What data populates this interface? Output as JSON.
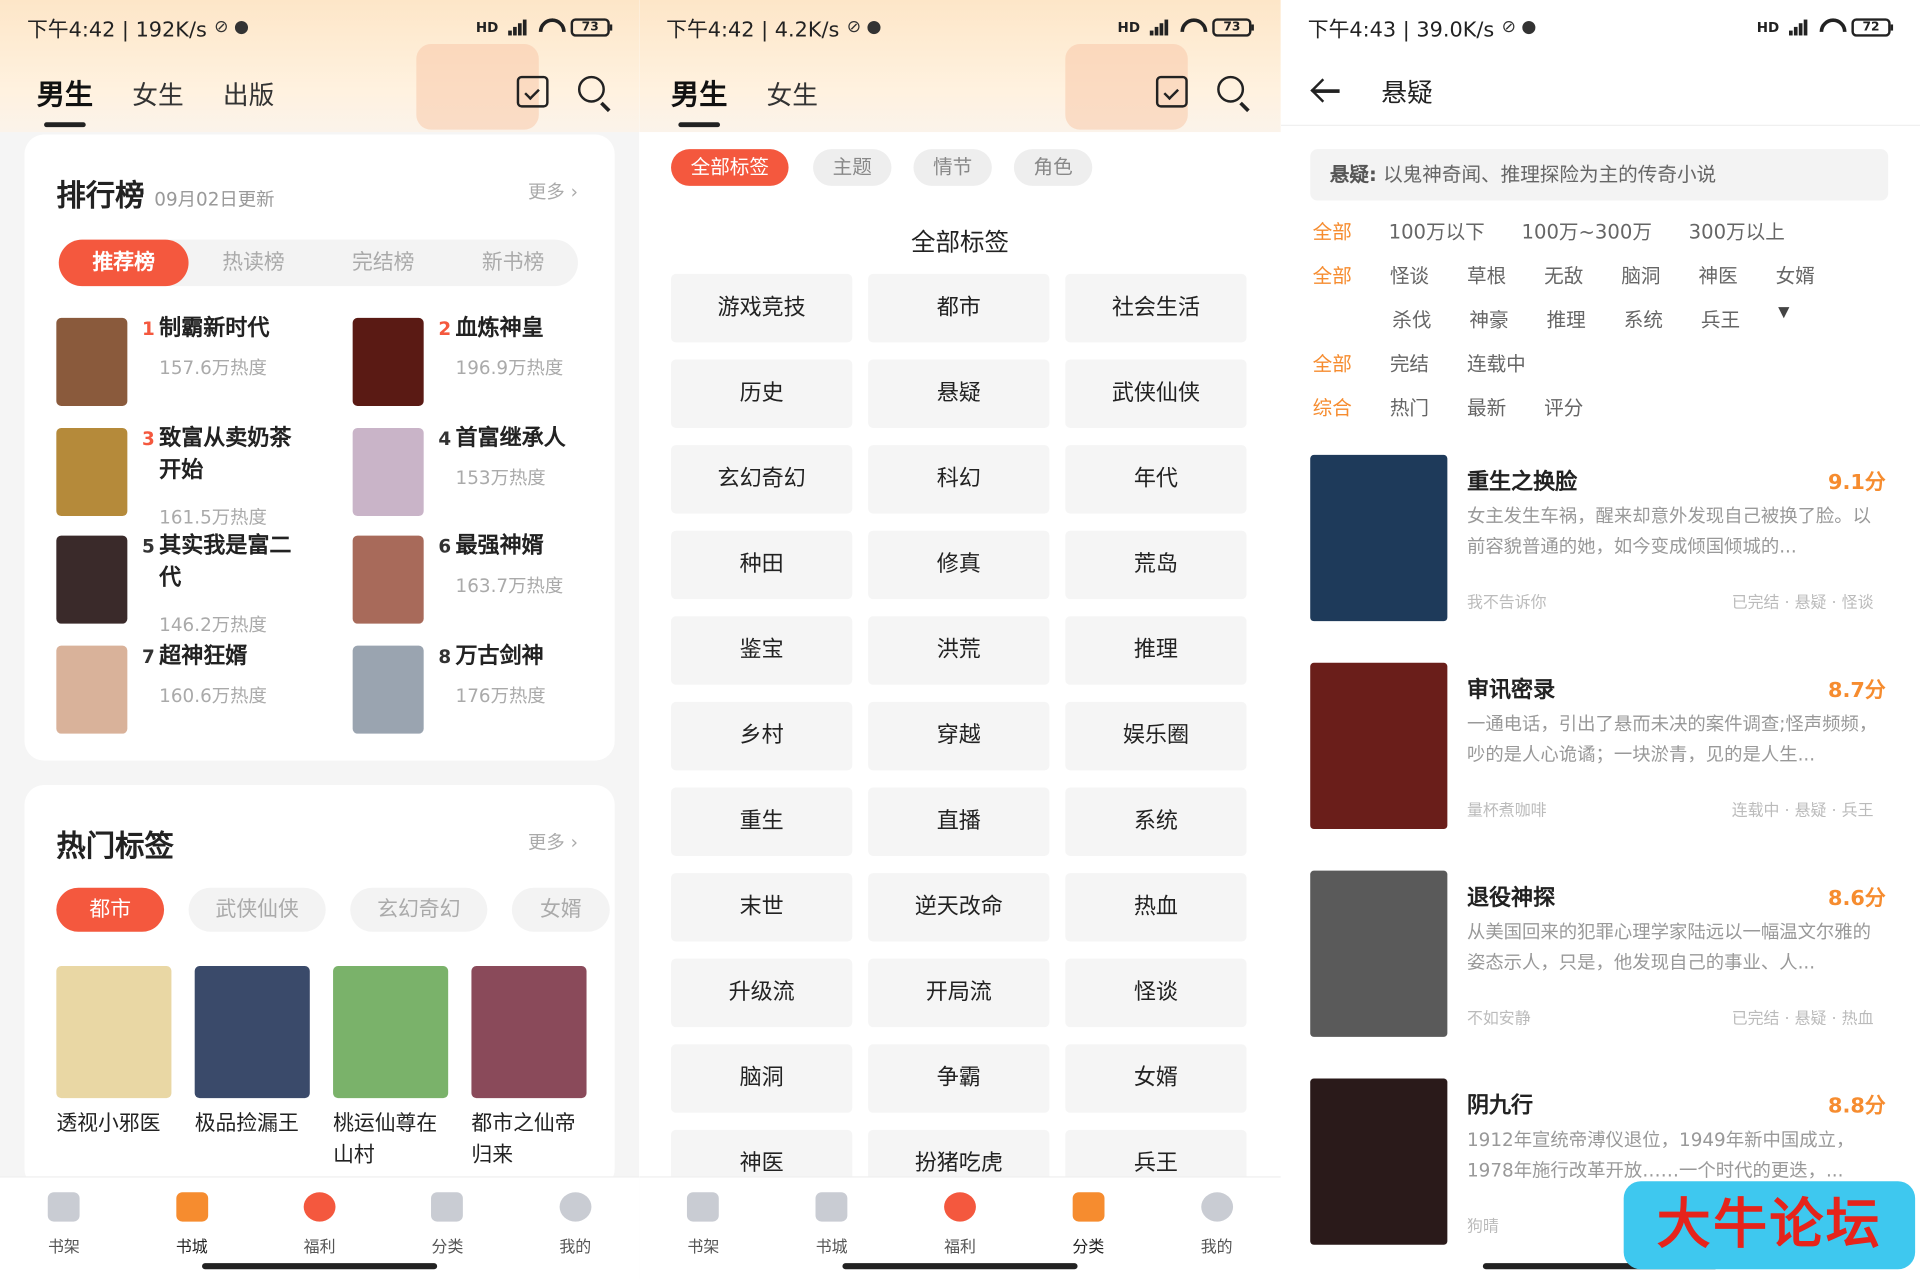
{
  "colors": {
    "accent": "#f4583e",
    "orange": "#f68c2f",
    "tab_inactive": "#c9ccd3"
  },
  "panels": [
    {
      "status": {
        "time": "下午4:42 | 192K/s",
        "battery": "73",
        "hd": "HD"
      },
      "tabs": [
        "男生",
        "女生",
        "出版"
      ],
      "active_tab": "男生"
    },
    {
      "status": {
        "time": "下午4:42 | 4.2K/s",
        "battery": "73",
        "hd": "HD"
      },
      "tabs": [
        "男生",
        "女生"
      ],
      "active_tab": "男生"
    },
    {
      "status": {
        "time": "下午4:43 | 39.0K/s",
        "battery": "72",
        "hd": "HD"
      }
    }
  ],
  "ranking": {
    "title": "排行榜",
    "updated": "09月02日更新",
    "more": "更多",
    "tabs": [
      "推荐榜",
      "热读榜",
      "完结榜",
      "新书榜"
    ],
    "active": "推荐榜",
    "items": [
      {
        "rank": "1",
        "name": "制霸新时代",
        "heat": "157.6万热度",
        "color": "#8a5a3c"
      },
      {
        "rank": "2",
        "name": "血炼神皇",
        "heat": "196.9万热度",
        "color": "#5a1a14"
      },
      {
        "rank": "3",
        "name": "致富从卖奶茶开始",
        "heat": "161.5万热度",
        "color": "#b58a3a"
      },
      {
        "rank": "4",
        "name": "首富继承人",
        "heat": "153万热度",
        "color": "#c9b4c8"
      },
      {
        "rank": "5",
        "name": "其实我是富二代",
        "heat": "146.2万热度",
        "color": "#3a2a2a"
      },
      {
        "rank": "6",
        "name": "最强神婿",
        "heat": "163.7万热度",
        "color": "#a86a5a"
      },
      {
        "rank": "7",
        "name": "超神狂婿",
        "heat": "160.6万热度",
        "color": "#d9b29a"
      },
      {
        "rank": "8",
        "name": "万古剑神",
        "heat": "176万热度",
        "color": "#9aa4b0"
      }
    ]
  },
  "hot_tags": {
    "title": "热门标签",
    "more": "更多",
    "tags": [
      "都市",
      "武侠仙侠",
      "玄幻奇幻",
      "女婿"
    ],
    "active": "都市",
    "books": [
      {
        "name": "透视小邪医",
        "color": "#e9d7a4"
      },
      {
        "name": "极品捡漏王",
        "color": "#3a4a6a"
      },
      {
        "name": "桃运仙尊在山村",
        "color": "#7ab26a"
      },
      {
        "name": "都市之仙帝归来",
        "color": "#8a4a5a"
      }
    ]
  },
  "tabbar": [
    "书架",
    "书城",
    "福利",
    "分类",
    "我的"
  ],
  "category": {
    "filters": [
      "全部标签",
      "主题",
      "情节",
      "角色"
    ],
    "active": "全部标签",
    "title": "全部标签",
    "tags": [
      "游戏竞技",
      "都市",
      "社会生活",
      "历史",
      "悬疑",
      "武侠仙侠",
      "玄幻奇幻",
      "科幻",
      "年代",
      "种田",
      "修真",
      "荒岛",
      "鉴宝",
      "洪荒",
      "推理",
      "乡村",
      "穿越",
      "娱乐圈",
      "重生",
      "直播",
      "系统",
      "末世",
      "逆天改命",
      "热血",
      "升级流",
      "开局流",
      "怪谈",
      "脑洞",
      "争霸",
      "女婿",
      "神医",
      "扮猪吃虎",
      "兵王"
    ]
  },
  "detail": {
    "title": "悬疑",
    "desc_label": "悬疑:",
    "desc": "以鬼神奇闻、推理探险为主的传奇小说",
    "word_filter": [
      "全部",
      "100万以下",
      "100万~300万",
      "300万以上"
    ],
    "tag_filter_1": [
      "全部",
      "怪谈",
      "草根",
      "无敌",
      "脑洞",
      "神医",
      "女婿"
    ],
    "tag_filter_2": [
      "杀伐",
      "神豪",
      "推理",
      "系统",
      "兵王"
    ],
    "status_filter": [
      "全部",
      "完结",
      "连载中"
    ],
    "sort_filter": [
      "综合",
      "热门",
      "最新",
      "评分"
    ],
    "results": [
      {
        "title": "重生之换脸",
        "score": "9.1分",
        "desc": "女主发生车祸，醒来却意外发现自己被换了脸。以前容貌普通的她，如今变成倾国倾城的...",
        "author": "我不告诉你",
        "meta": "已完结 · 悬疑 · 怪谈",
        "color": "#1e3a5a"
      },
      {
        "title": "审讯密录",
        "score": "8.7分",
        "desc": "一通电话，引出了悬而未决的案件调查;怪声频频，吵的是人心诡谲；一块淤青，见的是人生...",
        "author": "量杯煮咖啡",
        "meta": "连载中 · 悬疑 · 兵王",
        "color": "#6a1e1a"
      },
      {
        "title": "退役神探",
        "score": "8.6分",
        "desc": "从美国回来的犯罪心理学家陆远以一幅温文尔雅的姿态示人，只是，他发现自己的事业、人...",
        "author": "不如安静",
        "meta": "已完结 · 悬疑 · 热血",
        "color": "#5a5a5a"
      },
      {
        "title": "阴九行",
        "score": "8.8分",
        "desc": "1912年宣统帝溥仪退位，1949年新中国成立，1978年施行改革开放……一个时代的更迭，...",
        "author": "狗晴",
        "meta": "",
        "color": "#2a1a1a"
      }
    ]
  },
  "watermark": "大牛论坛"
}
